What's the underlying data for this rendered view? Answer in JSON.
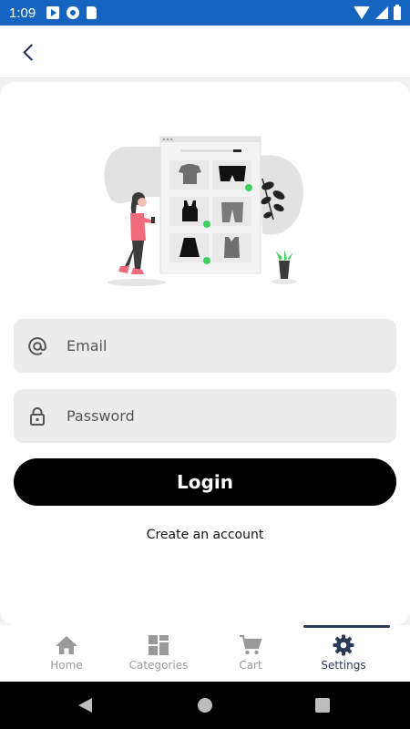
{
  "status_bar": {
    "time": "1:09"
  },
  "form": {
    "email_placeholder": "Email",
    "password_placeholder": "Password",
    "login_label": "Login",
    "create_account_label": "Create an account"
  },
  "bottom_nav": {
    "items": [
      {
        "label": "Home",
        "icon": "home-icon",
        "active": false
      },
      {
        "label": "Categories",
        "icon": "categories-icon",
        "active": false
      },
      {
        "label": "Cart",
        "icon": "cart-icon",
        "active": false
      },
      {
        "label": "Settings",
        "icon": "gear-icon",
        "active": true
      }
    ]
  },
  "colors": {
    "status_bar": "#1565c0",
    "accent": "#2b3a57",
    "button": "#000000",
    "field_bg": "#ececec",
    "illustration_accent": "#f06b7b"
  }
}
